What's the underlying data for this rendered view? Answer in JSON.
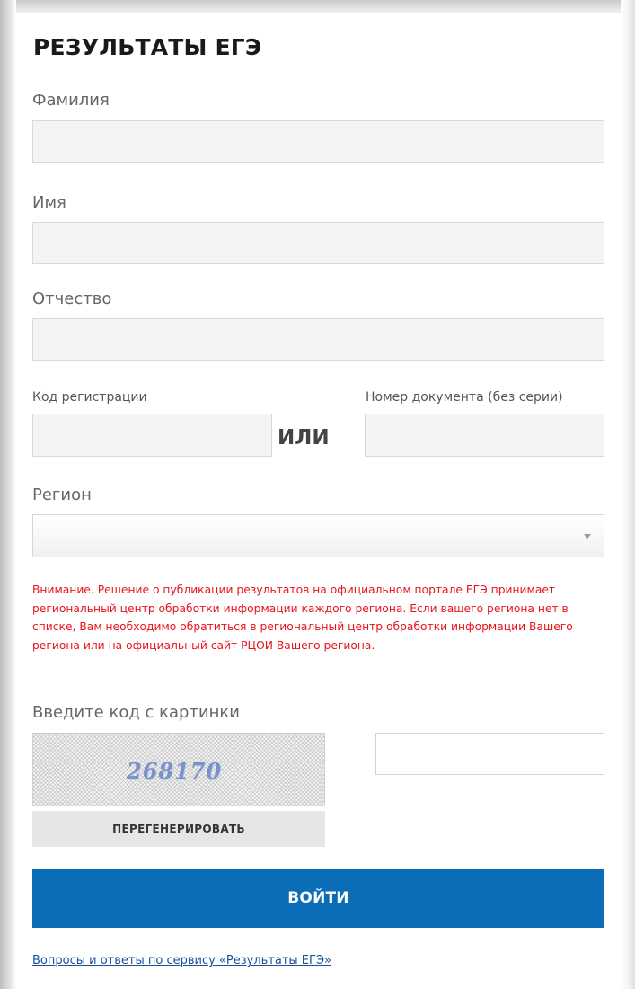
{
  "form": {
    "title": "РЕЗУЛЬТАТЫ ЕГЭ",
    "last_name": {
      "label": "Фамилия",
      "value": ""
    },
    "first_name": {
      "label": "Имя",
      "value": ""
    },
    "middle_name": {
      "label": "Отчество",
      "value": ""
    },
    "registration_code": {
      "label": "Код регистрации",
      "value": ""
    },
    "or_label": "ИЛИ",
    "document_number": {
      "label": "Номер документа (без серии)",
      "value": ""
    },
    "region": {
      "label": "Регион",
      "selected": ""
    },
    "warning": "Внимание. Решение о публикации результатов на  официальном портале ЕГЭ принимает региональный центр обработки информации каждого региона. Если вашего региона нет в списке, Вам необходимо обратиться в региональный центр обработки информации Вашего региона или на официальный сайт РЦОИ Вашего региона.",
    "captcha": {
      "label": "Введите код с картинки",
      "image_text": "268170",
      "value": "",
      "regenerate_label": "ПЕРЕГЕНЕРИРОВАТЬ"
    },
    "submit_label": "ВОЙТИ",
    "faq_link": "Вопросы и ответы по сервису «Результаты ЕГЭ»"
  },
  "colors": {
    "accent": "#0b6db7",
    "warning": "#e8141b",
    "link": "#1a4f9c",
    "field_background": "#f4f4f4"
  },
  "icons": {
    "select_arrow": "chevron-down-icon"
  }
}
